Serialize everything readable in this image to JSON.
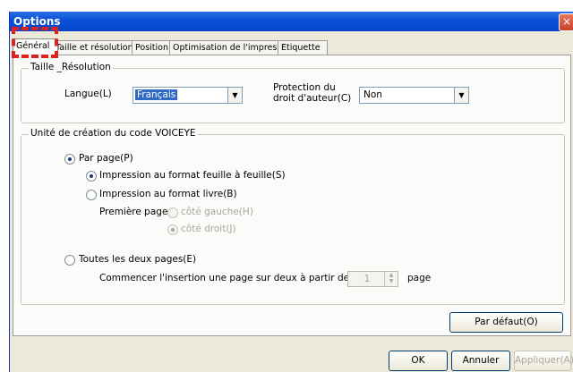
{
  "window": {
    "title": "Options",
    "close_glyph": "×"
  },
  "tabs": [
    {
      "label": "Général",
      "active": true
    },
    {
      "label": "Taille et résolution"
    },
    {
      "label": "Position"
    },
    {
      "label": "Optimisation de l'impression"
    },
    {
      "label": "Etiquette"
    }
  ],
  "taille_group": {
    "title": "Taille _Résolution",
    "langue_label": "Langue(L)",
    "langue_value": "Français",
    "protection_label_line1": "Protection du",
    "protection_label_line2": "droit d'auteur(C)",
    "protection_value": "Non"
  },
  "voiceye_group": {
    "title": "Unité de création du code VOICEYE",
    "par_page": {
      "label": "Par page(P)",
      "checked": true
    },
    "feuille": {
      "label": "Impression au format feuille à feuille(S)",
      "checked": true
    },
    "livre": {
      "label": "Impression au format livre(B)",
      "checked": false
    },
    "premiere_page_label": "Première page",
    "cote_gauche": {
      "label": "côté gauche(H)",
      "checked": false
    },
    "cote_droit": {
      "label": "côté droit(J)",
      "checked": true
    },
    "toutes": {
      "label": "Toutes les deux pages(E)",
      "checked": false
    },
    "commencer_label": "Commencer l'insertion une page sur deux à partir de la(U)",
    "commencer_value": "1",
    "page_label": "page"
  },
  "buttons": {
    "par_defaut": "Par défaut(O)",
    "ok": "OK",
    "annuler": "Annuler",
    "appliquer": "Appliquer(A)"
  },
  "colors": {
    "titlebar": "#0a4fd8",
    "selection": "#316ac5",
    "highlight_marker": "#e0201a",
    "dialog_bg": "#ece9d8"
  }
}
